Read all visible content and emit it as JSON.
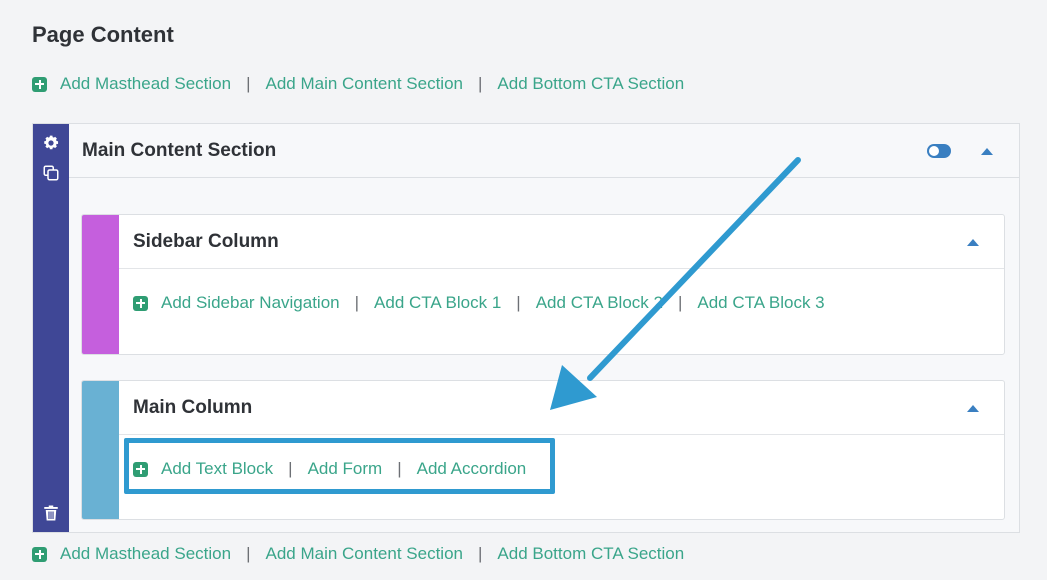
{
  "page": {
    "title": "Page Content"
  },
  "section_actions_top": {
    "add_masthead": "Add Masthead Section",
    "add_main_content": "Add Main Content Section",
    "add_bottom_cta": "Add Bottom CTA Section",
    "separator": "|"
  },
  "section_actions_bottom": {
    "add_masthead": "Add Masthead Section",
    "add_main_content": "Add Main Content Section",
    "add_bottom_cta": "Add Bottom CTA Section",
    "separator": "|"
  },
  "main_section": {
    "title": "Main Content Section",
    "rail_icons": [
      "gear-icon",
      "copy-icon",
      "trash-icon"
    ],
    "visibility_toggle_on": true,
    "sidebar_column": {
      "title": "Sidebar Column",
      "stripe_color": "#c55fdd",
      "actions": [
        "Add Sidebar Navigation",
        "Add CTA Block 1",
        "Add CTA Block 2",
        "Add CTA Block 3"
      ],
      "separator": "|"
    },
    "main_column": {
      "title": "Main Column",
      "stripe_color": "#69b1d3",
      "actions": [
        "Add Text Block",
        "Add Form",
        "Add Accordion"
      ],
      "separator": "|"
    }
  },
  "colors": {
    "link": "#3aa58a",
    "plus_icon": "#2f9d73",
    "rail": "#3f4796",
    "toggle": "#3a7fc1",
    "annotation": "#2f9ad0"
  }
}
